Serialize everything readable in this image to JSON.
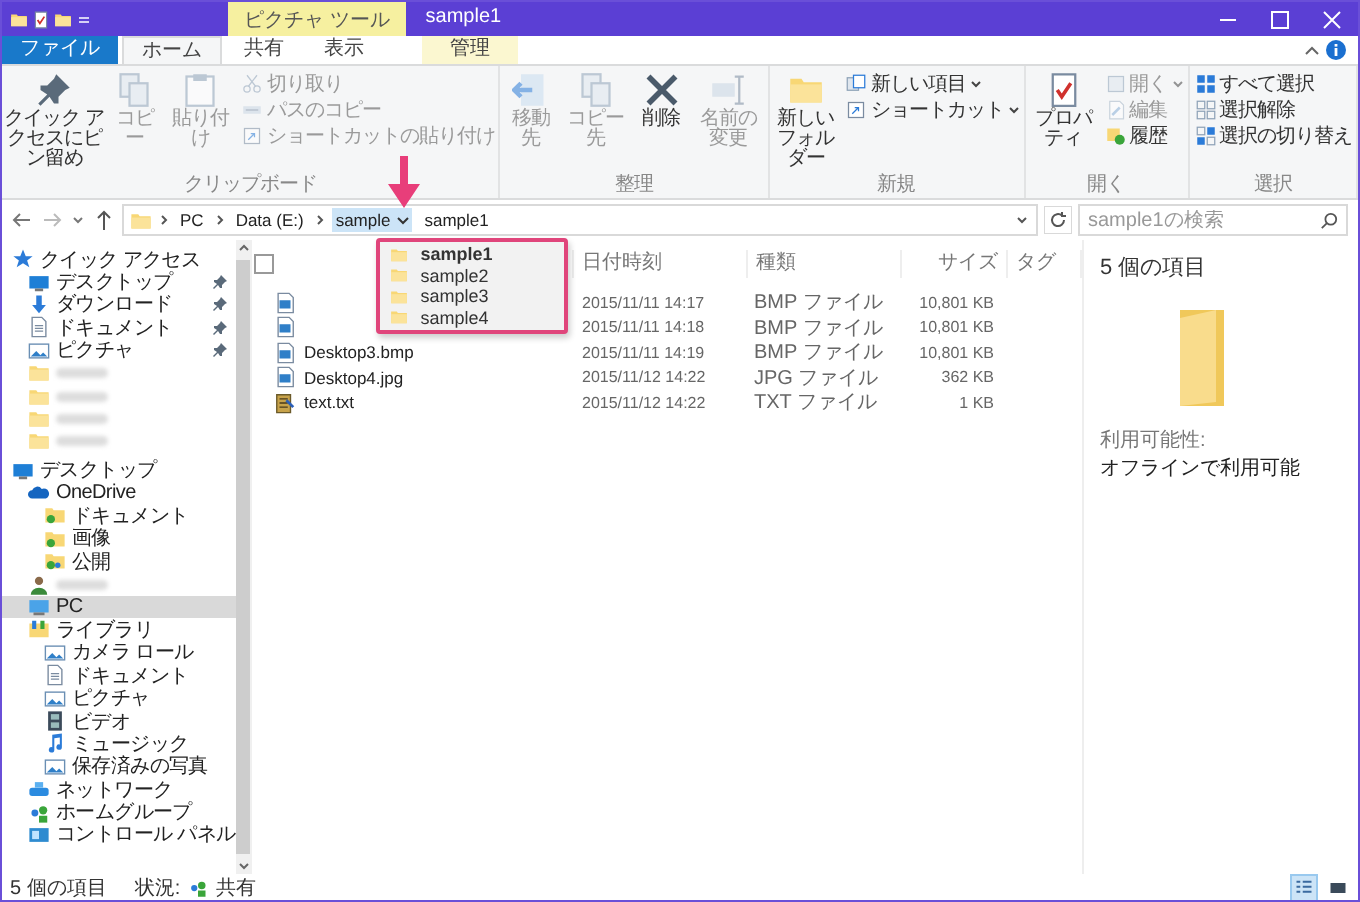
{
  "window": {
    "title": "sample1",
    "context_tab": "ピクチャ ツール"
  },
  "ribbon_tabs": [
    {
      "label": "ファイル",
      "kind": "file",
      "selected": false
    },
    {
      "label": "ホーム",
      "kind": "normal",
      "selected": true
    },
    {
      "label": "共有",
      "kind": "normal",
      "selected": false
    },
    {
      "label": "表示",
      "kind": "normal",
      "selected": false
    },
    {
      "label": "管理",
      "kind": "context",
      "selected": false
    }
  ],
  "ribbon_groups": [
    {
      "label": "クリップボード",
      "buttons": [
        {
          "label": "クイック アクセスにピン留め",
          "large": true,
          "kind": "pin",
          "disabled": false,
          "menu": false
        },
        {
          "label": "コピー",
          "large": true,
          "kind": "copy",
          "disabled": true,
          "menu": false
        },
        {
          "label": "貼り付け",
          "large": true,
          "kind": "paste",
          "disabled": true,
          "menu": false
        },
        {
          "label": "切り取り",
          "large": false,
          "kind": "cut",
          "disabled": true,
          "menu": false
        },
        {
          "label": "パスのコピー",
          "large": false,
          "kind": "path",
          "disabled": true,
          "menu": false
        },
        {
          "label": "ショートカットの貼り付け",
          "large": false,
          "kind": "shortcut",
          "disabled": true,
          "menu": false
        }
      ]
    },
    {
      "label": "整理",
      "buttons": [
        {
          "label": "移動先",
          "large": true,
          "kind": "move",
          "disabled": true,
          "menu": false
        },
        {
          "label": "コピー先",
          "large": true,
          "kind": "copyto",
          "disabled": true,
          "menu": false
        },
        {
          "label": "削除",
          "large": true,
          "kind": "delete",
          "disabled": false,
          "menu": false
        },
        {
          "label": "名前の変更",
          "large": true,
          "kind": "rename",
          "disabled": true,
          "menu": false
        }
      ]
    },
    {
      "label": "新規",
      "buttons": [
        {
          "label": "新しいフォルダー",
          "large": true,
          "kind": "folder",
          "disabled": false,
          "menu": false
        },
        {
          "label": "新しい項目",
          "large": false,
          "kind": "newitem",
          "disabled": false,
          "menu": true
        },
        {
          "label": "ショートカット",
          "large": false,
          "kind": "shortcut",
          "disabled": false,
          "menu": true
        }
      ]
    },
    {
      "label": "開く",
      "buttons": [
        {
          "label": "プロパティ",
          "large": true,
          "kind": "properties",
          "disabled": false,
          "menu": false
        },
        {
          "label": "開く",
          "large": false,
          "kind": "open",
          "disabled": true,
          "menu": true
        },
        {
          "label": "編集",
          "large": false,
          "kind": "edit",
          "disabled": true,
          "menu": false
        },
        {
          "label": "履歴",
          "large": false,
          "kind": "history",
          "disabled": false,
          "menu": false
        }
      ]
    },
    {
      "label": "選択",
      "buttons": [
        {
          "label": "すべて選択",
          "large": false,
          "kind": "selectall",
          "disabled": false,
          "menu": false
        },
        {
          "label": "選択解除",
          "large": false,
          "kind": "selectnone",
          "disabled": false,
          "menu": false
        },
        {
          "label": "選択の切り替え",
          "large": false,
          "kind": "invert",
          "disabled": false,
          "menu": false
        }
      ]
    }
  ],
  "address": {
    "crumbs": [
      {
        "label": "PC",
        "selected": false
      },
      {
        "label": "Data (E:)",
        "selected": false
      },
      {
        "label": "sample",
        "selected": true
      },
      {
        "label": "sample1",
        "selected": false
      }
    ],
    "search": {
      "placeholder": "sample1の検索"
    }
  },
  "dropdown": {
    "items": [
      {
        "label": "sample1",
        "current": true
      },
      {
        "label": "sample2",
        "current": false
      },
      {
        "label": "sample3",
        "current": false
      },
      {
        "label": "sample4",
        "current": false
      }
    ]
  },
  "sidebar": {
    "items": [
      {
        "label": "クイック アクセス",
        "kind": "quick",
        "selected": false,
        "children": [
          {
            "label": "デスクトップ",
            "kind": "desktop",
            "pinned": true,
            "selected": false
          },
          {
            "label": "ダウンロード",
            "kind": "download",
            "pinned": true,
            "selected": false
          },
          {
            "label": "ドキュメント",
            "kind": "document",
            "pinned": true,
            "selected": false
          },
          {
            "label": "ピクチャ",
            "kind": "picture",
            "pinned": true,
            "selected": false
          },
          {
            "kind": "folder",
            "blurred": true,
            "pinned": false,
            "selected": false
          },
          {
            "kind": "folder",
            "blurred": true,
            "pinned": false,
            "selected": false
          },
          {
            "kind": "folder",
            "blurred": true,
            "pinned": false,
            "selected": false
          },
          {
            "kind": "folder",
            "blurred": true,
            "pinned": false,
            "selected": false
          }
        ]
      },
      {
        "label": "デスクトップ",
        "kind": "desktop",
        "selected": false,
        "children": [
          {
            "label": "OneDrive",
            "kind": "onedrive",
            "selected": false,
            "children": [
              {
                "label": "ドキュメント",
                "kind": "syncfolder",
                "selected": false
              },
              {
                "label": "画像",
                "kind": "syncfolder",
                "selected": false
              },
              {
                "label": "公開",
                "kind": "sharedfolder",
                "selected": false
              }
            ]
          },
          {
            "kind": "user",
            "blurred": true,
            "selected": false
          },
          {
            "label": "PC",
            "kind": "pc",
            "selected": true
          },
          {
            "label": "ライブラリ",
            "kind": "library",
            "selected": false,
            "children": [
              {
                "label": "カメラ ロール",
                "kind": "picture",
                "selected": false
              },
              {
                "label": "ドキュメント",
                "kind": "document",
                "selected": false
              },
              {
                "label": "ピクチャ",
                "kind": "picture",
                "selected": false
              },
              {
                "label": "ビデオ",
                "kind": "video",
                "selected": false
              },
              {
                "label": "ミュージック",
                "kind": "music",
                "selected": false
              },
              {
                "label": "保存済みの写真",
                "kind": "picture",
                "selected": false
              }
            ]
          },
          {
            "label": "ネットワーク",
            "kind": "network",
            "selected": false
          },
          {
            "label": "ホームグループ",
            "kind": "homegroup",
            "selected": false
          },
          {
            "label": "コントロール パネル",
            "kind": "panel",
            "selected": false
          }
        ]
      }
    ]
  },
  "file_list": {
    "select_all": {
      "checked": false
    },
    "columns": [
      {
        "label": "日付時刻"
      },
      {
        "label": "種類"
      },
      {
        "label": "サイズ"
      },
      {
        "label": "タグ"
      }
    ],
    "rows": [
      {
        "kind": "image",
        "date": "2015/11/11 14:17",
        "type": "BMP ファイル",
        "size": "10,801 KB"
      },
      {
        "kind": "image",
        "date": "2015/11/11 14:18",
        "type": "BMP ファイル",
        "size": "10,801 KB"
      },
      {
        "kind": "image",
        "name": "Desktop3.bmp",
        "date": "2015/11/11 14:19",
        "type": "BMP ファイル",
        "size": "10,801 KB"
      },
      {
        "kind": "image",
        "name": "Desktop4.jpg",
        "date": "2015/11/12 14:22",
        "type": "JPG ファイル",
        "size": "362 KB"
      },
      {
        "kind": "text",
        "name": "text.txt",
        "date": "2015/11/12 14:22",
        "type": "TXT ファイル",
        "size": "1 KB"
      }
    ]
  },
  "details": {
    "heading": "5 個の項目",
    "fields": [
      {
        "label": "利用可能性:",
        "value": "オフラインで利用可能"
      }
    ]
  },
  "status_bar": {
    "count": "5 個の項目",
    "state_label": "状況:",
    "state_value": "共有",
    "views": [
      {
        "kind": "details",
        "selected": true
      },
      {
        "kind": "tiles",
        "selected": false
      }
    ]
  }
}
